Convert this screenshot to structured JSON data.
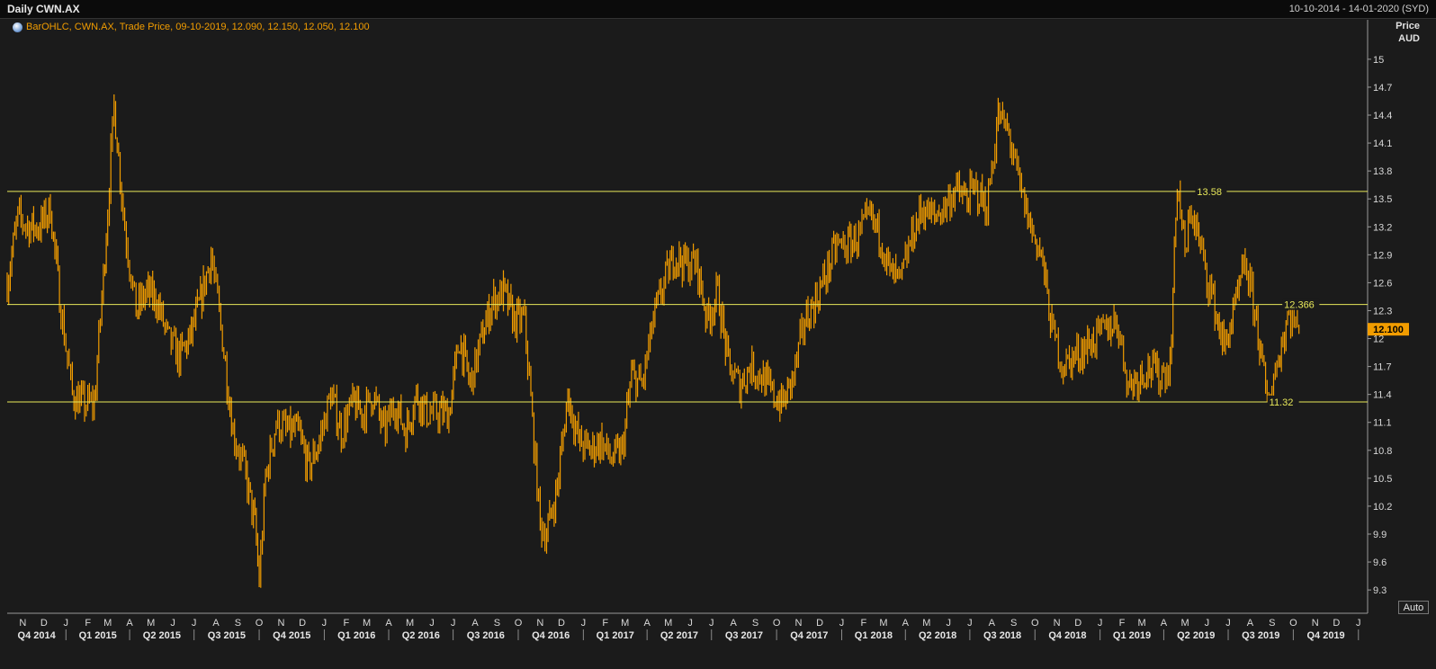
{
  "header": {
    "title": "Daily CWN.AX",
    "date_range": "10-10-2014 - 14-01-2020 (SYD)"
  },
  "legend": {
    "icon": "globe-icon",
    "text": "BarOHLC, CWN.AX, Trade Price, 09-10-2019, 12.090, 12.150, 12.050, 12.100"
  },
  "y_axis": {
    "title_line1": "Price",
    "title_line2": "AUD"
  },
  "controls": {
    "auto_label": "Auto"
  },
  "colors": {
    "background": "#1b1b1b",
    "grid": "#333333",
    "price_bars": "#f29d00",
    "level_lines": "#e8e85a",
    "last_price_badge": "#f29d00"
  },
  "chart_data": {
    "type": "bar",
    "ylim": [
      9.05,
      15.25
    ],
    "y_ticks": [
      15,
      14.7,
      14.4,
      14.1,
      13.8,
      13.5,
      13.2,
      12.9,
      12.6,
      12.3,
      12,
      11.7,
      11.4,
      11.1,
      10.8,
      10.5,
      10.2,
      9.9,
      9.6,
      9.3
    ],
    "last_price": "12.100",
    "x_start": "2014-10-10",
    "x_end": "2020-01-14",
    "month_labels": [
      "N",
      "D",
      "J",
      "F",
      "M",
      "A",
      "M",
      "J",
      "J",
      "A",
      "S",
      "O",
      "N",
      "D",
      "J",
      "F",
      "M",
      "A",
      "M",
      "J",
      "J",
      "A",
      "S",
      "O",
      "N",
      "D",
      "J",
      "F",
      "M",
      "A",
      "M",
      "J",
      "J",
      "A",
      "S",
      "O",
      "N",
      "D",
      "J",
      "F",
      "M",
      "A",
      "M",
      "J",
      "J",
      "A",
      "S",
      "O",
      "N",
      "D",
      "J",
      "F",
      "M",
      "A",
      "M",
      "J",
      "J",
      "A",
      "S",
      "O",
      "N",
      "D",
      "J"
    ],
    "quarter_labels": [
      "Q4 2014",
      "Q1 2015",
      "Q2 2015",
      "Q3 2015",
      "Q4 2015",
      "Q1 2016",
      "Q2 2016",
      "Q3 2016",
      "Q4 2016",
      "Q1 2017",
      "Q2 2017",
      "Q3 2017",
      "Q4 2017",
      "Q1 2018",
      "Q2 2018",
      "Q3 2018",
      "Q4 2018",
      "Q1 2019",
      "Q2 2019",
      "Q3 2019",
      "Q4 2019"
    ],
    "horizontal_lines": [
      {
        "value": 13.58,
        "label": "13.58"
      },
      {
        "value": 12.366,
        "label": "12.366"
      },
      {
        "value": 11.32,
        "label": "11.32"
      }
    ],
    "series": [
      {
        "x": [
          "2014-10-10",
          "2014-10-25",
          "2014-11-10",
          "2014-11-25",
          "2014-12-10",
          "2014-12-25",
          "2015-01-10",
          "2015-01-25",
          "2015-02-10",
          "2015-02-25",
          "2015-03-01",
          "2015-03-10",
          "2015-03-25",
          "2015-04-10",
          "2015-04-25",
          "2015-05-10",
          "2015-05-25",
          "2015-06-10",
          "2015-06-25",
          "2015-07-10",
          "2015-07-25",
          "2015-08-10",
          "2015-08-25",
          "2015-09-10",
          "2015-09-25",
          "2015-10-01",
          "2015-10-10",
          "2015-10-25",
          "2015-11-10",
          "2015-11-25",
          "2015-12-10",
          "2015-12-25",
          "2016-01-10",
          "2016-01-25",
          "2016-02-10",
          "2016-02-25",
          "2016-03-10",
          "2016-03-25",
          "2016-04-10",
          "2016-04-25",
          "2016-05-10",
          "2016-05-25",
          "2016-06-10",
          "2016-06-25",
          "2016-07-10",
          "2016-07-25",
          "2016-08-10",
          "2016-08-25",
          "2016-09-10",
          "2016-09-25",
          "2016-10-10",
          "2016-11-01",
          "2016-11-10",
          "2016-11-25",
          "2016-12-10",
          "2016-12-25",
          "2017-01-10",
          "2017-01-25",
          "2017-02-10",
          "2017-02-25",
          "2017-03-10",
          "2017-03-25",
          "2017-04-10",
          "2017-04-25",
          "2017-05-10",
          "2017-05-25",
          "2017-06-10",
          "2017-06-25",
          "2017-07-10",
          "2017-07-25",
          "2017-08-10",
          "2017-08-25",
          "2017-09-10",
          "2017-09-25",
          "2017-10-10",
          "2017-10-25",
          "2017-11-10",
          "2017-11-25",
          "2017-12-10",
          "2017-12-25",
          "2018-01-10",
          "2018-01-25",
          "2018-02-10",
          "2018-02-25",
          "2018-03-10",
          "2018-03-25",
          "2018-04-10",
          "2018-04-25",
          "2018-05-10",
          "2018-05-25",
          "2018-06-10",
          "2018-06-25",
          "2018-07-10",
          "2018-07-25",
          "2018-08-10",
          "2018-08-25",
          "2018-09-10",
          "2018-09-25",
          "2018-10-10",
          "2018-10-25",
          "2018-11-10",
          "2018-11-25",
          "2018-12-10",
          "2018-12-25",
          "2019-01-10",
          "2019-01-25",
          "2019-02-10",
          "2019-02-25",
          "2019-03-10",
          "2019-03-25",
          "2019-04-10",
          "2019-04-20",
          "2019-05-01",
          "2019-05-10",
          "2019-05-25",
          "2019-06-10",
          "2019-06-25",
          "2019-07-10",
          "2019-07-25",
          "2019-08-10",
          "2019-08-25",
          "2019-09-10",
          "2019-09-25",
          "2019-10-09"
        ],
        "values": [
          12.6,
          13.3,
          13.2,
          13.2,
          13.4,
          12.3,
          11.4,
          11.3,
          11.3,
          12.9,
          13.4,
          14.5,
          13.2,
          12.3,
          12.5,
          12.4,
          12.0,
          11.8,
          12.0,
          12.4,
          12.9,
          12.0,
          11.0,
          10.6,
          10.0,
          9.4,
          10.5,
          11.1,
          11.0,
          11.0,
          10.6,
          10.9,
          11.4,
          11.0,
          11.3,
          11.2,
          11.4,
          11.0,
          11.3,
          11.0,
          11.4,
          11.2,
          11.2,
          11.2,
          12.0,
          11.5,
          12.0,
          12.4,
          12.5,
          12.2,
          12.2,
          10.0,
          9.9,
          10.4,
          11.4,
          10.9,
          10.8,
          10.9,
          10.7,
          10.8,
          11.6,
          11.5,
          12.2,
          12.6,
          12.9,
          12.8,
          12.8,
          12.2,
          12.5,
          11.7,
          11.5,
          11.7,
          11.6,
          11.4,
          11.3,
          11.6,
          12.2,
          12.4,
          12.7,
          13.0,
          13.0,
          13.1,
          13.3,
          13.1,
          12.7,
          12.6,
          13.1,
          13.4,
          13.3,
          13.4,
          13.6,
          13.5,
          13.6,
          13.4,
          14.4,
          14.2,
          13.6,
          13.2,
          12.9,
          12.1,
          11.7,
          11.8,
          11.9,
          12.0,
          12.1,
          12.2,
          11.5,
          11.6,
          11.7,
          11.6,
          11.7,
          13.7,
          12.9,
          13.4,
          12.9,
          12.4,
          11.9,
          12.3,
          12.8,
          12.2,
          11.3,
          11.8,
          12.3,
          12.1
        ]
      }
    ]
  }
}
